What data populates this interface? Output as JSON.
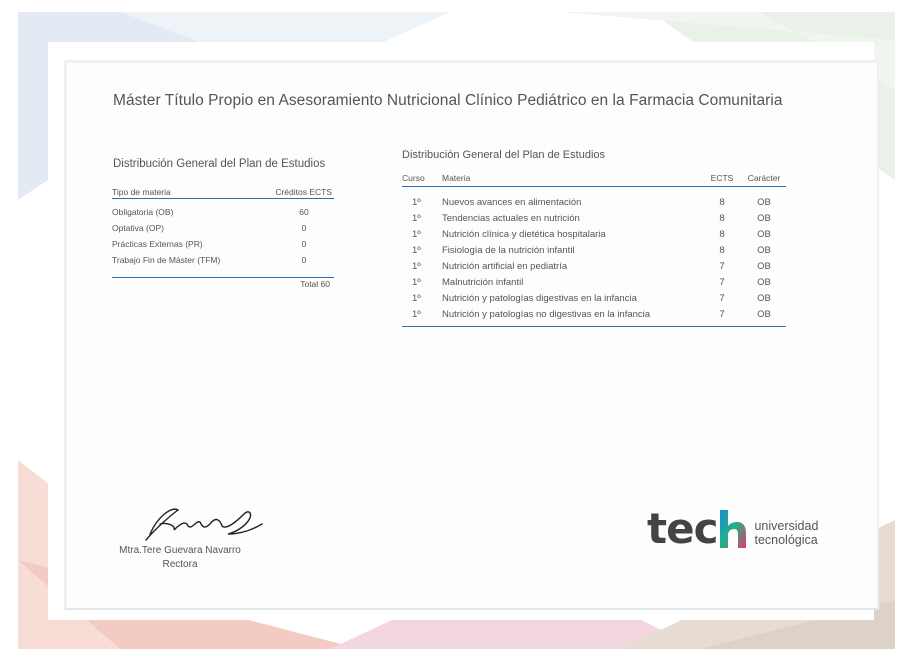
{
  "title": "Máster Título Propio en Asesoramiento Nutricional Clínico Pediátrico en la Farmacia Comunitaria",
  "left_table": {
    "title": "Distribución General del Plan de Estudios",
    "headers": [
      "Tipo de materia",
      "Créditos ECTS"
    ],
    "rows": [
      {
        "type": "Obligatoria (OB)",
        "credits": "60"
      },
      {
        "type": "Optativa (OP)",
        "credits": "0"
      },
      {
        "type": "Prácticas Externas (PR)",
        "credits": "0"
      },
      {
        "type": "Trabajo Fin de Máster (TFM)",
        "credits": "0"
      }
    ],
    "total": "Total 60"
  },
  "right_table": {
    "title": "Distribución General del Plan de Estudios",
    "headers": [
      "Curso",
      "Materia",
      "ECTS",
      "Carácter"
    ],
    "rows": [
      {
        "curso": "1º",
        "materia": "Nuevos avances en alimentación",
        "ects": "8",
        "caracter": "OB"
      },
      {
        "curso": "1º",
        "materia": "Tendencias actuales en nutrición",
        "ects": "8",
        "caracter": "OB"
      },
      {
        "curso": "1º",
        "materia": "Nutrición clínica y dietética hospitalaria",
        "ects": "8",
        "caracter": "OB"
      },
      {
        "curso": "1º",
        "materia": "Fisiología de la nutrición infantil",
        "ects": "8",
        "caracter": "OB"
      },
      {
        "curso": "1º",
        "materia": "Nutrición artificial en pediatría",
        "ects": "7",
        "caracter": "OB"
      },
      {
        "curso": "1º",
        "materia": "Malnutrición infantil",
        "ects": "7",
        "caracter": "OB"
      },
      {
        "curso": "1º",
        "materia": "Nutrición y patologías digestivas en la infancia",
        "ects": "7",
        "caracter": "OB"
      },
      {
        "curso": "1º",
        "materia": "Nutrición y patologías no digestivas en la infancia",
        "ects": "7",
        "caracter": "OB"
      }
    ]
  },
  "signature": {
    "name": "Mtra.Tere Guevara Navarro",
    "role": "Rectora"
  },
  "logo": {
    "word": "tec",
    "line1": "universidad",
    "line2": "tecnológica",
    "accent_colors": [
      "#1a8fd0",
      "#22b08a",
      "#e33b6f"
    ]
  },
  "colors": {
    "rule_blue": "#2a6fbf"
  }
}
